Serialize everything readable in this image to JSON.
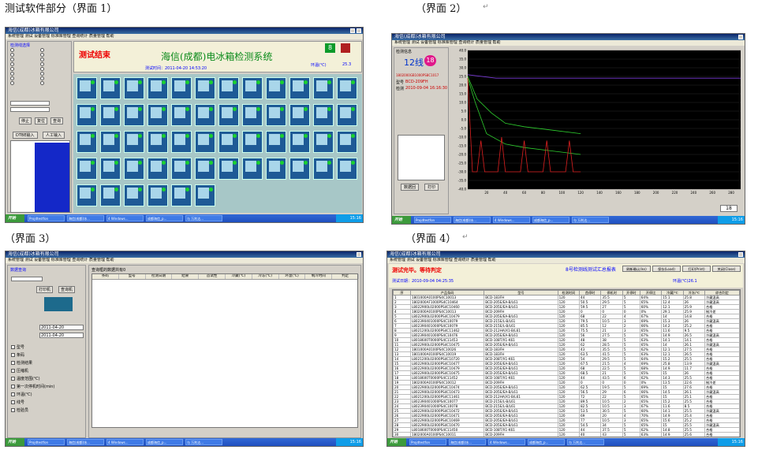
{
  "captions": {
    "s1": "测试软件部分（界面 1）",
    "s2": "（界面 2）",
    "s3": "（界面 3）",
    "s4": "（界面 4）"
  },
  "app_title": "海信(成都)冰箱有限公司",
  "menu": "系统管理  测试  设备管理  标准库管理  查询统计  质量管理  帮助",
  "s1": {
    "banner_status": "测试结束",
    "banner_title": "海信(成都)电冰箱检测系统",
    "line_label": "8",
    "temp_label": "环温(℃)",
    "temp_value": "25.3",
    "test_time": "测试时间：2011-04-20 14:53:20",
    "sidebar_title": "检测线选择",
    "btn_barcode": "DTBE输入",
    "btn_manual": "人工输入",
    "btn_stop": "停止",
    "btn_reset": "复位",
    "btn_query": "查询"
  },
  "s2": {
    "panel_title": "检测信息",
    "line": "12线",
    "station": "18",
    "model_label": "型号",
    "model": "BCD-209FH",
    "barcode": "1802000GB1000PS8C1017",
    "detect_label": "检测",
    "detect_time": "2010-09-04 16:16:30",
    "save_btn": "数据回",
    "print_btn": "打印",
    "y_ticks": [
      "40.0",
      "35.0",
      "30.0",
      "25.0",
      "20.0",
      "15.0",
      "10.0",
      "5.0",
      "0.0",
      "-5.0",
      "-10.0",
      "-15.0",
      "-20.0",
      "-25.0",
      "-30.0",
      "-35.0",
      "-40.0"
    ],
    "x_ticks": [
      "20",
      "40",
      "60",
      "80",
      "100",
      "120",
      "140",
      "160",
      "180",
      "200",
      "220",
      "240",
      "260",
      "280"
    ],
    "zoom_value": "18"
  },
  "s3": {
    "panel_title": "数据查询",
    "result_title": "查询框的数据共有0",
    "columns": [
      "条码",
      "型号",
      "检测日期",
      "结果",
      "首试性",
      "冷藏(℃)",
      "冷冻(℃)",
      "环温(℃)",
      "制冷时间",
      "判定"
    ],
    "date_from": "2011-04-20",
    "date_to": "2011-04-20",
    "filters": [
      "型号",
      "条码",
      "检测结果",
      "压缩机",
      "温度范围(℃)",
      "第一次停机时间(min)",
      "环温(℃)",
      "线号",
      "检验员"
    ],
    "print_btn": "打印机",
    "query_btn": "查询机"
  },
  "s4": {
    "panel_title": "8号检测线测试汇总报表",
    "status_text": "测试完毕。等待判定",
    "date_label": "测试日期：2010-09-04 04:25:35",
    "report_title": "8号检测线测试汇总报表",
    "env_temp": "环温(℃)26.1",
    "buttons": [
      "刷新确认(Iss)",
      "保存(Load)",
      "打印(Print)",
      "关闭(Close)"
    ],
    "columns": [
      "序",
      "产品条码",
      "型号",
      "检测时间",
      "首停时",
      "停机时",
      "开停时",
      "开停比",
      "冷藏/℃",
      "冷冻/℃",
      "综合判定"
    ],
    "rows": [
      [
        "1",
        "1801000A0100PS4C10013",
        "BCD-183FH",
        "120",
        "44",
        "35.5",
        "5",
        "64%",
        "15.1",
        "25.8",
        "冷藏温高"
      ],
      [
        "2",
        "1802000AF1000PS4C10464",
        "BCD-205E/EA-B/L61",
        "120",
        "50.5",
        "29.5",
        "5",
        "65%",
        "12.4",
        "26",
        "冷藏温高"
      ],
      [
        "3",
        "L8022900L02000PS4C10460",
        "BCD-205E/EA-B/L61",
        "120",
        "59.5",
        "27",
        "5",
        "60%",
        "12.1",
        "25.9",
        "合格"
      ],
      [
        "4",
        "1802000A0100PS4C10013",
        "BCD-209FH",
        "120",
        "0",
        "0",
        "0",
        "0%",
        "29.1",
        "25.9",
        "制冷差"
      ],
      [
        "5",
        "L8022900L02000PS4C10479",
        "BCD-205E/EA-B/L61",
        "120",
        "68",
        "22",
        "4",
        "67%",
        "14",
        "14.8",
        "合格"
      ],
      [
        "6",
        "L802390401000PS4C10079",
        "BCD-215E/L-B/L61",
        "120",
        "79.5",
        "10.5",
        "3",
        "69%",
        "15.3",
        "26",
        "冷藏温高"
      ],
      [
        "7",
        "L802390401000PS4C10079",
        "BCD-215E/L-B/L61",
        "120",
        "85.5",
        "12",
        "2",
        "66%",
        "14.2",
        "25.2",
        "合格"
      ],
      [
        "8",
        "L8021200L02000PS4C11462",
        "BCD-212HA/X1-B/L61",
        "120",
        "75.5",
        "21",
        "3",
        "65%",
        "11.6",
        "9.5",
        "合格"
      ],
      [
        "9",
        "L802390401000PS4C10476",
        "BCD-205E/EA-B/L61",
        "120",
        "56",
        "27.5",
        "5",
        "67%",
        "14.9",
        "26.5",
        "冷藏温高"
      ],
      [
        "10",
        "L8018600T0000PS4C11453",
        "BCD-108T/X1-K61",
        "120",
        "48",
        "38",
        "5",
        "63%",
        "14.1",
        "14.1",
        "合格"
      ],
      [
        "11",
        "L8022900L02000PS4C10475",
        "BCD-205E/EA-B/L61",
        "120",
        "62",
        "28.5",
        "5",
        "65%",
        "14",
        "26.1",
        "冷藏温高"
      ],
      [
        "12",
        "1801000A0100PS4C10026",
        "BCD-183FH",
        "120",
        "43",
        "35.5",
        "5",
        "62%",
        "12.1",
        "27.5",
        "合格"
      ],
      [
        "13",
        "1801000A0100PS4C10019",
        "BCD-183FH",
        "120",
        "63.5",
        "41.5",
        "5",
        "63%",
        "12.1",
        "26.5",
        "合格"
      ],
      [
        "14",
        "L8021200L02000PS4C10720",
        "BCD-208T/X1-K61",
        "120",
        "54",
        "29.5",
        "5",
        "64%",
        "15.2",
        "25.5",
        "合格"
      ],
      [
        "15",
        "L8022900L02000PS4C10477",
        "BCD-205E/EA-B/L61",
        "120",
        "67.5",
        "21.5",
        "4",
        "69%",
        "25.8",
        "13.9",
        "冷藏温高"
      ],
      [
        "16",
        "L8022900L02000PS4C10479",
        "BCD-205E/EA-B/L61",
        "120",
        "68",
        "22.5",
        "5",
        "68%",
        "14.9",
        "11.7",
        "合格"
      ],
      [
        "17",
        "L8022900L02000PS4C10475",
        "BCD-205E/EA-B/L61",
        "120",
        "68.5",
        "21",
        "5",
        "65%",
        "15",
        "26",
        "合格"
      ],
      [
        "18",
        "L8018600T0000PS4C11452",
        "BCD-108T/X1-K61",
        "120",
        "44",
        "43.5",
        "6",
        "62%",
        "14.3",
        "25.5",
        "合格"
      ],
      [
        "19",
        "1802000A0100PS4C10012",
        "BCD-209FH",
        "120",
        "0",
        "0",
        "0",
        "0%",
        "13.5",
        "22.6",
        "制冷差"
      ],
      [
        "20",
        "L8022900L02000PS4C10474",
        "BCD-205E/EA-B/L61",
        "120",
        "62.5",
        "19.5",
        "5",
        "69%",
        "15",
        "27.6",
        "合格"
      ],
      [
        "21",
        "L8022900L02000PS4C10473",
        "BCD-205E/EA-B/L61",
        "120",
        "56.5",
        "29",
        "6",
        "66%",
        "14.5",
        "26.1",
        "冷藏温高"
      ],
      [
        "22",
        "L8021200L02000PS4C11461",
        "BCD-212HA/X1-B/L61",
        "120",
        "72",
        "22",
        "5",
        "65%",
        "15",
        "25.1",
        "合格"
      ],
      [
        "23",
        "L802390401000PS4C10077",
        "BCD-215E/L-B/L61",
        "120",
        "89.5",
        "10.5",
        "2",
        "65%",
        "15.2",
        "25.5",
        "合格"
      ],
      [
        "24",
        "L802390401000PS4C10078",
        "BCD-215E/L-B/L61",
        "120",
        "82.5",
        "10.5",
        "3",
        "67%",
        "11.6",
        "8.5",
        "合格"
      ],
      [
        "25",
        "L8022900L02000PS4C10472",
        "BCD-205E/EA-B/L61",
        "120",
        "53.5",
        "30.5",
        "5",
        "60%",
        "14.1",
        "25.5",
        "冷藏温高"
      ],
      [
        "26",
        "L8022900L02000PS4C10471",
        "BCD-205E/EA-B/L61",
        "120",
        "69",
        "20",
        "4",
        "70%",
        "14.9",
        "25.4",
        "合格"
      ],
      [
        "27",
        "L8022900L02000PS4C10469",
        "BCD-205E/EA-B/L61",
        "120",
        "77",
        "10.5",
        "3",
        "65%",
        "15.6",
        "25.2",
        "合格"
      ],
      [
        "28",
        "L8022900L02000PS4C10470",
        "BCD-205E/EA-B/L61",
        "120",
        "54.5",
        "34",
        "5",
        "65%",
        "15",
        "25.5",
        "冷藏温高"
      ],
      [
        "29",
        "L8018600T0000PS4C11450",
        "BCD-108T/X1-K61",
        "120",
        "44",
        "37.5",
        "5",
        "62%",
        "14.8",
        "25.5",
        "合格"
      ],
      [
        "30",
        "1802000A0100PS4C10011",
        "BCD-209FH",
        "120",
        "40",
        "43",
        "5",
        "63%",
        "14.9",
        "25.6",
        "合格"
      ]
    ]
  },
  "taskbar": {
    "start": "开始",
    "items": [
      "Projdtestfon",
      "海信(成都)冰...",
      "4 Windows...",
      "成都海信_p...",
      "与 万利达..."
    ],
    "clock": "15:16"
  }
}
